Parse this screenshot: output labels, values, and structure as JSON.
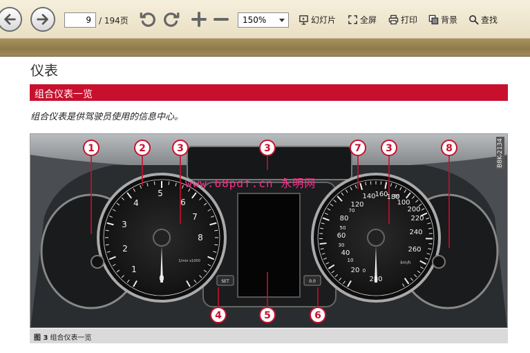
{
  "toolbar": {
    "back_icon": "arrow-left-icon",
    "forward_icon": "arrow-right-icon",
    "page_current": "9",
    "page_total": "/ 194页",
    "rotate_left_icon": "rotate-ccw-icon",
    "rotate_right_icon": "rotate-cw-icon",
    "zoom_in_icon": "plus-icon",
    "zoom_out_icon": "minus-icon",
    "zoom_level": "150%",
    "slideshow_label": "幻灯片",
    "fullscreen_label": "全屏",
    "print_label": "打印",
    "background_label": "背景",
    "search_label": "查找"
  },
  "document": {
    "title": "仪表",
    "section_header": "组合仪表一览",
    "intro": "组合仪表是供驾驶员使用的信息中心。",
    "watermark": "www.68pdf.cn 永明网",
    "figure_id": "B8K-2134",
    "caption_label": "图 3",
    "caption_text": "组合仪表一览",
    "callouts": [
      "1",
      "2",
      "3",
      "3",
      "7",
      "3",
      "8",
      "4",
      "5",
      "6"
    ],
    "tachometer_numbers": [
      "1",
      "2",
      "3",
      "4",
      "5",
      "6",
      "7",
      "8",
      "0"
    ],
    "tacho_unit": "1/min x1000",
    "speedometer_numbers": [
      "20",
      "40",
      "60",
      "80",
      "100",
      "120",
      "140",
      "160",
      "180",
      "200",
      "220",
      "240",
      "260",
      "280",
      "0",
      "10",
      "30",
      "50",
      "70",
      "90"
    ],
    "speed_unit": "km/h",
    "set_label": "SET",
    "zero_label": "0.0"
  },
  "colors": {
    "accent_red": "#c8102e",
    "toolbar_bg": "#f6efdc",
    "band": "#8f7a4c"
  }
}
